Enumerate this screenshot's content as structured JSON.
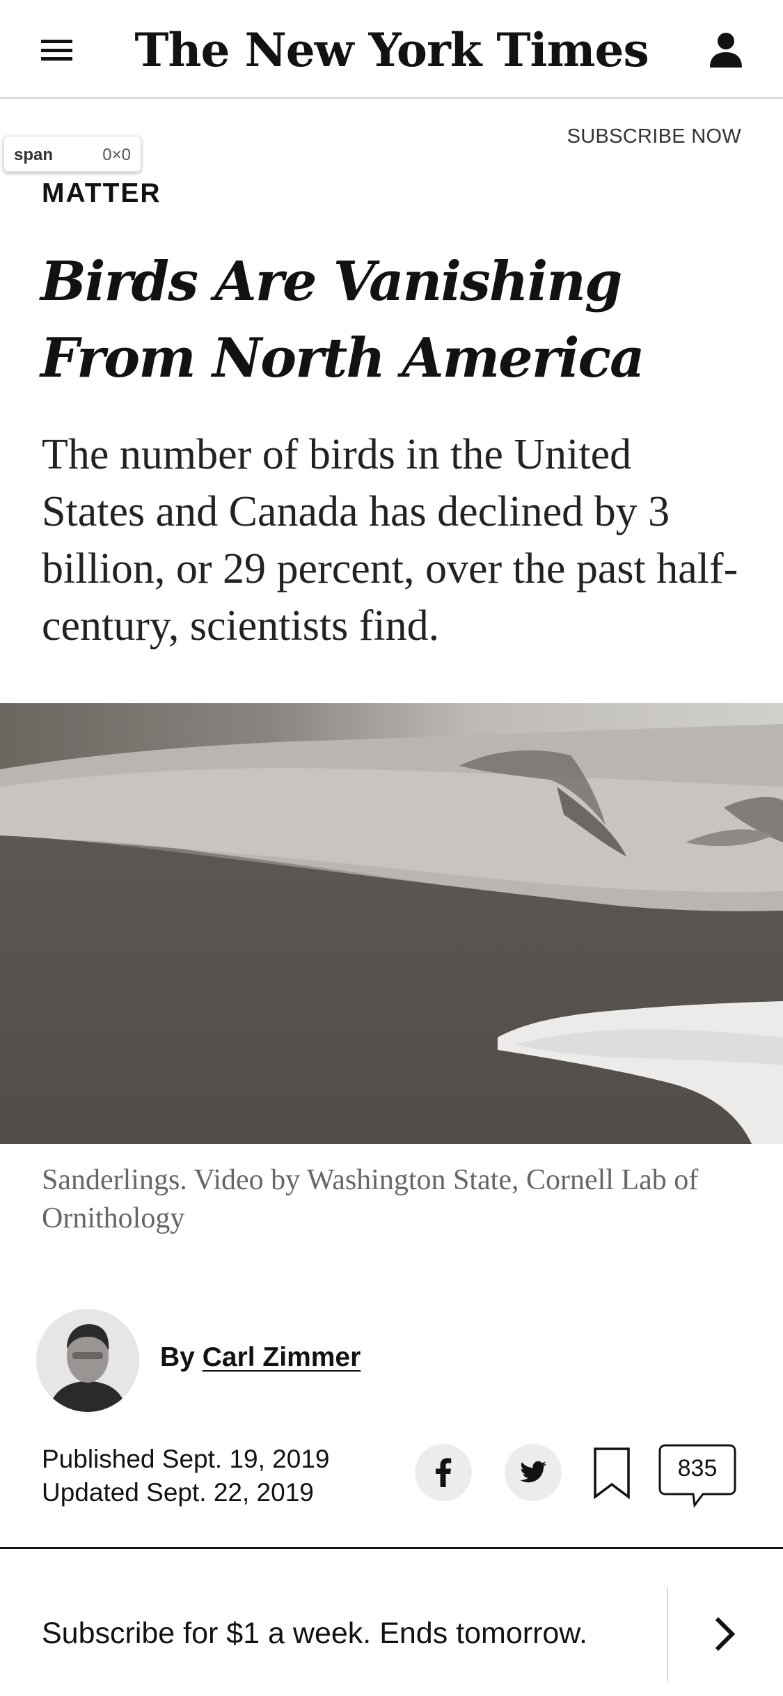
{
  "header": {
    "logo_text": "The New York Times",
    "subscribe_label": "SUBSCRIBE NOW"
  },
  "devtools_tooltip": {
    "tag": "span",
    "size": "0×0"
  },
  "article": {
    "kicker": "MATTER",
    "headline_line1": "Birds Are Vanishing",
    "headline_line2": "From North America",
    "summary": "The number of birds in the United States and Canada has declined by 3 billion, or 29 percent, over the past half-century, scientists find.",
    "media_caption": "Sanderlings. Video by Washington State, Cornell Lab of Ornithology",
    "byline_prefix": "By",
    "author": "Carl Zimmer",
    "published": "Published Sept. 19, 2019",
    "updated": "Updated Sept. 22, 2019",
    "comment_count": "835"
  },
  "icons": {
    "menu": "hamburger-menu-icon",
    "account": "person-icon",
    "facebook": "facebook-icon",
    "twitter": "twitter-icon",
    "save": "bookmark-icon",
    "comments": "speech-bubble-icon",
    "next": "chevron-right-icon"
  },
  "banner": {
    "text": "Subscribe for $1 a week. Ends tomorrow."
  },
  "colors": {
    "text": "#121212",
    "caption": "#666666",
    "share_bg": "#ececec"
  }
}
